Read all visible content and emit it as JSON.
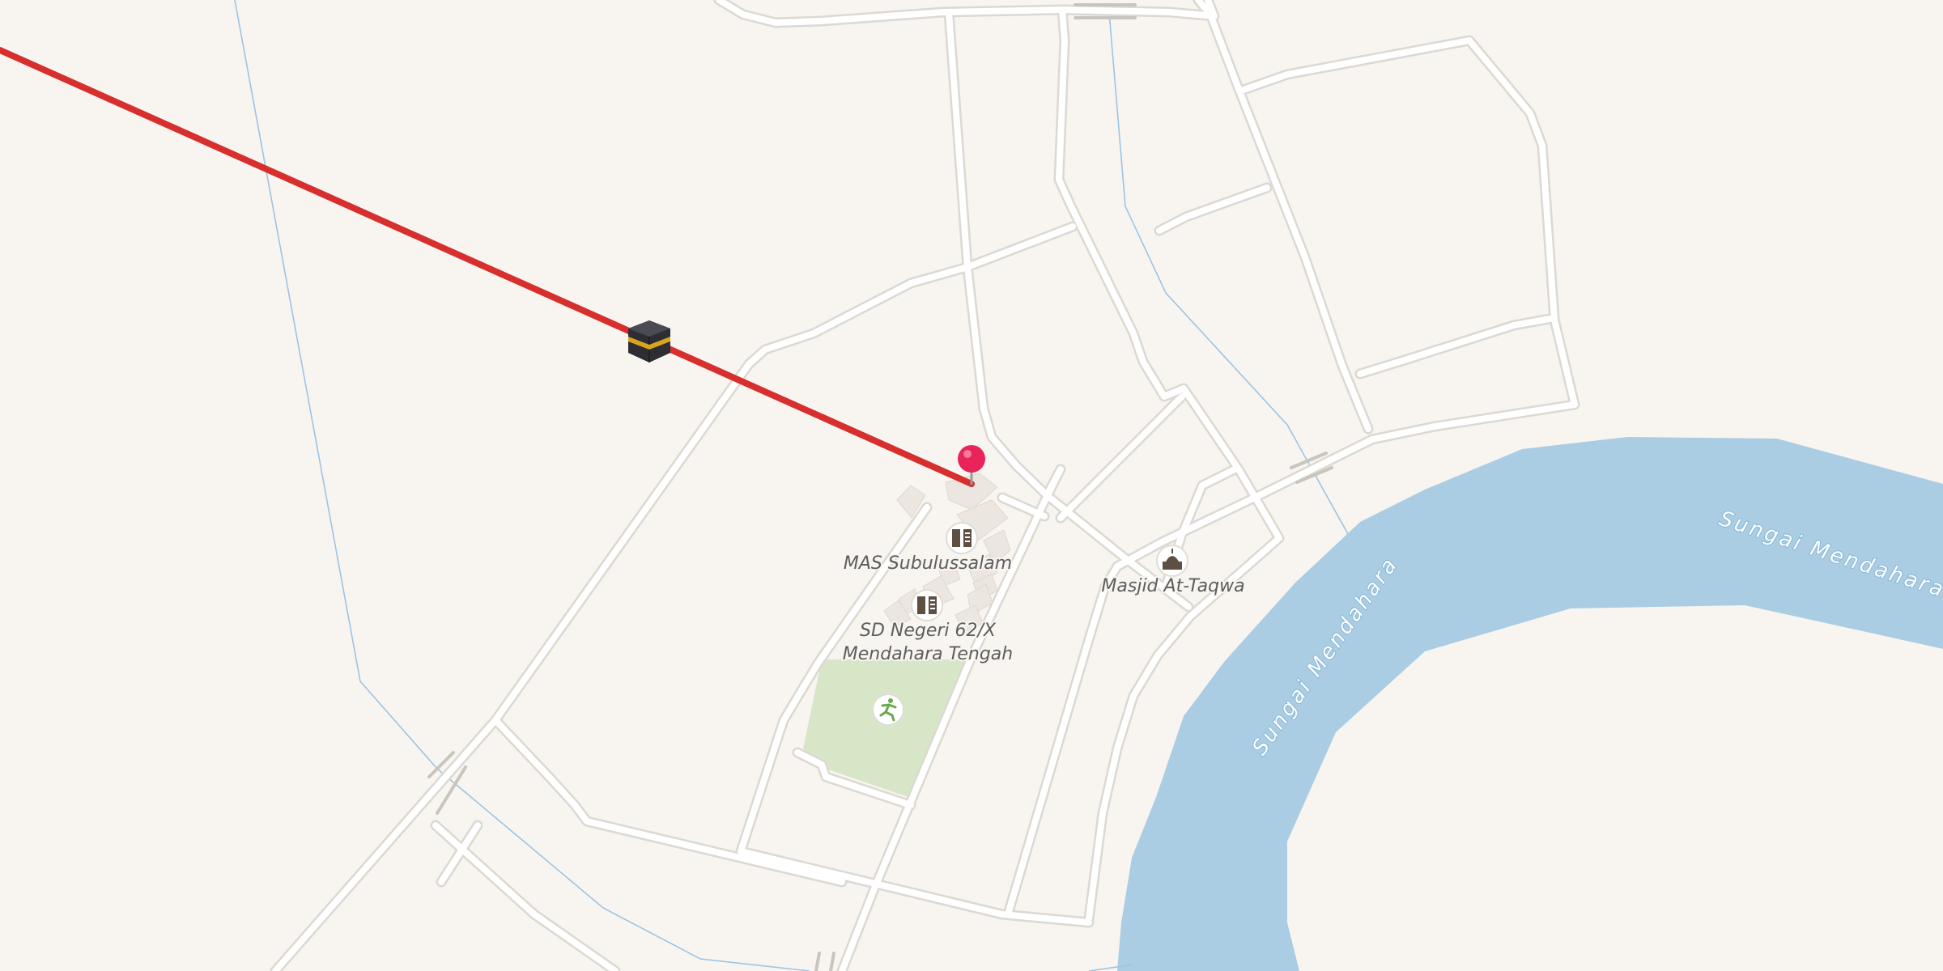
{
  "map": {
    "colors": {
      "background": "#f8f5f1",
      "road_casing": "#dcd8d2",
      "road_fill": "#ffffff",
      "water": "#abcde3",
      "park": "#d8e6c8",
      "stream": "#9cc4e4",
      "route_line": "#d72e2e",
      "pin": "#e8245b"
    },
    "route": {
      "label": ""
    },
    "destination_marker": {
      "icon": "kaaba-icon"
    },
    "location_pin": {
      "icon": "map-pin-icon"
    },
    "pois": [
      {
        "name": "MAS Subulussalam",
        "icon": "school-icon"
      },
      {
        "name_line1": "SD Negeri 62/X",
        "name_line2": "Mendahara Tengah",
        "icon": "school-icon"
      },
      {
        "name": "Masjid At-Taqwa",
        "icon": "mosque-icon"
      },
      {
        "name": "",
        "icon": "sports-field-icon"
      }
    ],
    "rivers": [
      {
        "name": "Sungai Mendahara"
      },
      {
        "name": "Sungai Mendahara"
      }
    ]
  }
}
